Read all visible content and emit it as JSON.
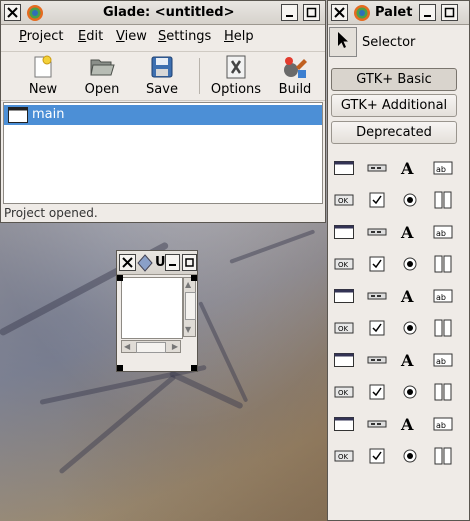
{
  "main_window": {
    "title": "Glade: <untitled>",
    "menu": [
      {
        "label": "Project",
        "mnemonic": "P",
        "rest": "roject"
      },
      {
        "label": "Edit",
        "mnemonic": "E",
        "rest": "dit"
      },
      {
        "label": "View",
        "mnemonic": "V",
        "rest": "iew"
      },
      {
        "label": "Settings",
        "mnemonic": "S",
        "rest": "ettings"
      },
      {
        "label": "Help",
        "mnemonic": "H",
        "rest": "elp"
      }
    ],
    "toolbar": {
      "new": "New",
      "open": "Open",
      "save": "Save",
      "options": "Options",
      "build": "Build"
    },
    "tree_items": [
      "main"
    ],
    "status": "Project opened."
  },
  "palette_window": {
    "title": "Palet",
    "selector": "Selector",
    "categories": [
      "GTK+ Basic",
      "GTK+ Additional",
      "Deprecated"
    ],
    "active_category": "GTK+ Basic",
    "widgets": [
      "window-widget-icon",
      "menubar-widget-icon",
      "toolbar-widget-icon",
      "handlebox-widget-icon",
      "dialog-widget-icon",
      "file-selection-widget-icon",
      "radio-dialog-widget-icon",
      "vruler-widget-icon",
      "label-widget-icon",
      "entry-widget-icon",
      "list-widget-icon",
      "text-view-widget-icon",
      "ok-button-widget-icon",
      "toggle-button-widget-icon",
      "check-button-widget-icon",
      "radio-button-widget-icon",
      "combo-widget-icon",
      "option-menu-widget-icon",
      "spin-button-widget-icon",
      "tree-view-widget-icon",
      "hseparator-widget-icon",
      "vseparator-widget-icon",
      "image-widget-icon",
      "drawing-area-widget-icon",
      "dialog-frame-widget-icon",
      "file-chooser-widget-icon",
      "color-selection-widget-icon",
      "font-selection-widget-icon",
      "hbox-widget-icon",
      "vbox-widget-icon",
      "table-widget-icon",
      "fixed-widget-icon",
      "hbuttonbox-widget-icon",
      "vbuttonbox-widget-icon",
      "vscale-widget-icon",
      "hscale-widget-icon",
      "notebook-widget-icon",
      "frame-widget-icon",
      "scrolled-window-widget-icon",
      "alignment-widget-icon"
    ]
  },
  "mini_window": {
    "title": "U"
  }
}
